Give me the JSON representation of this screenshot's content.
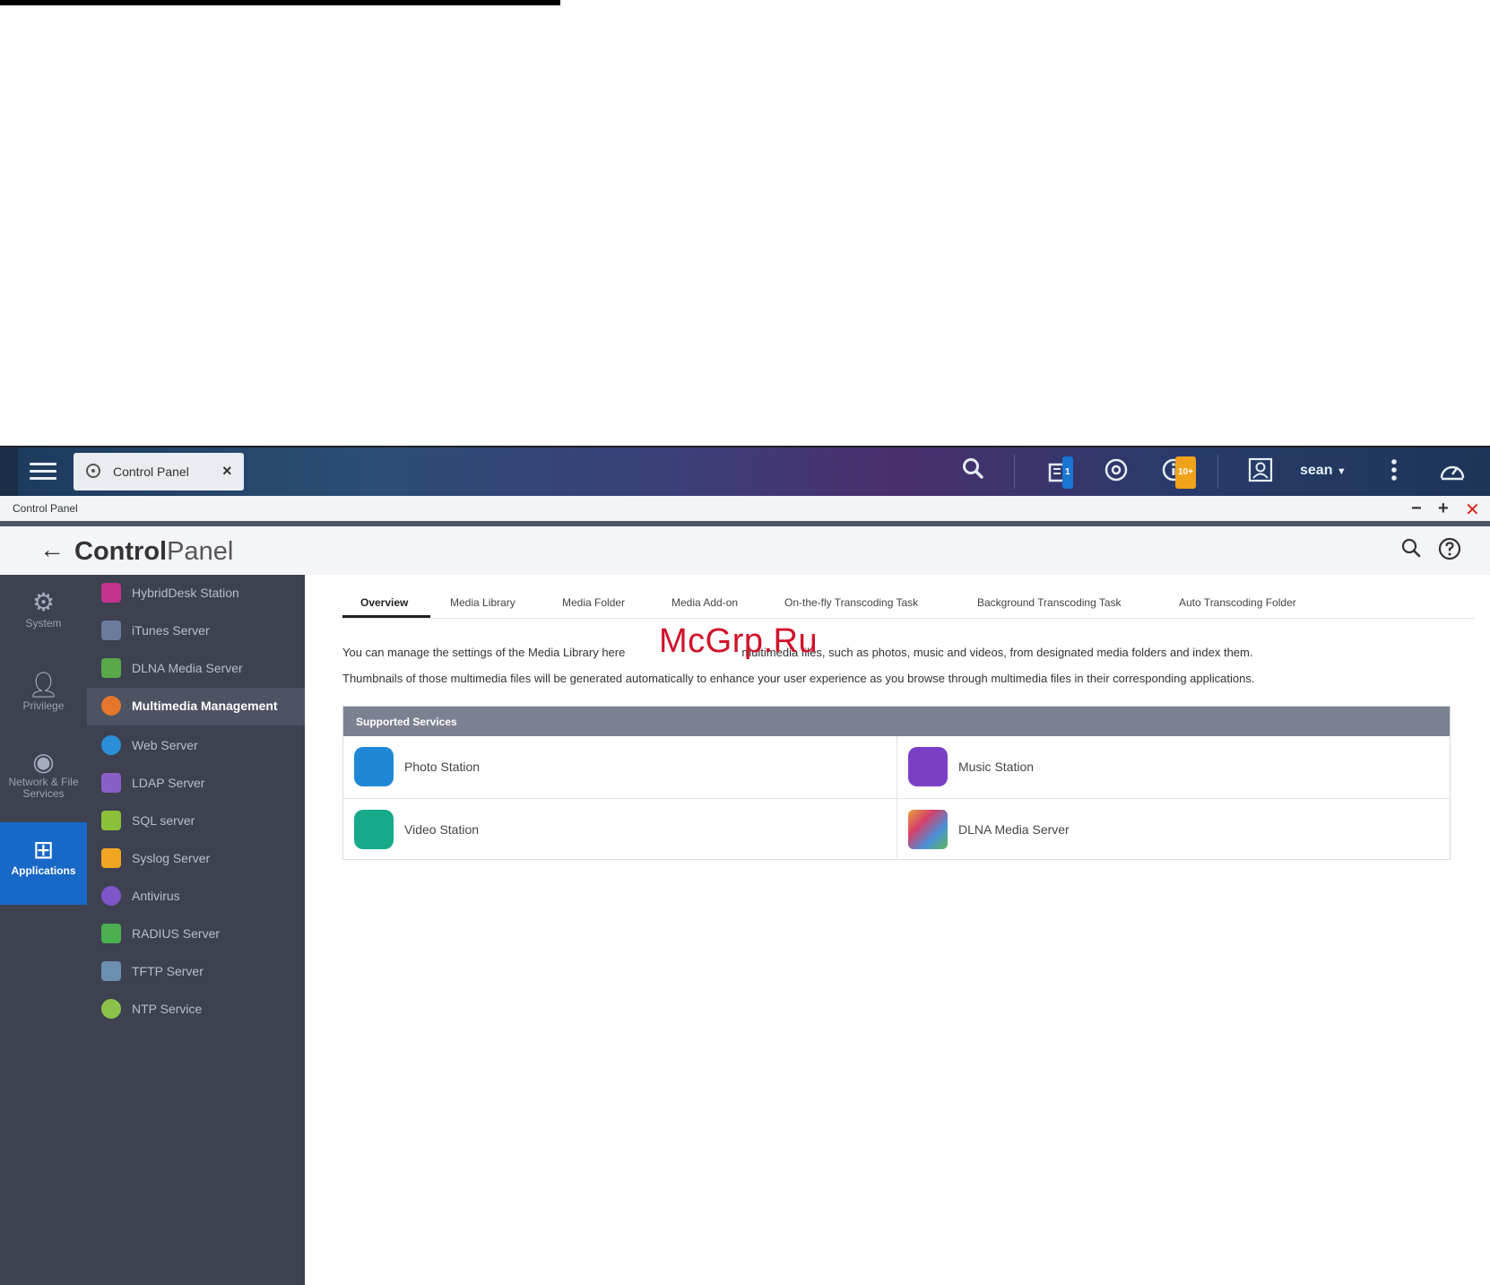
{
  "watermark": "McGrp.Ru",
  "taskbar": {
    "app_tab_label": "Control Panel",
    "notification_badge": "1",
    "events_badge": "10+",
    "user": "sean"
  },
  "window": {
    "title": "Control Panel",
    "header_title_bold": "Control",
    "header_title_light": "Panel"
  },
  "categories": [
    {
      "label": "System"
    },
    {
      "label": "Privilege"
    },
    {
      "label": "Network & File Services"
    },
    {
      "label": "Applications"
    }
  ],
  "sub_items": [
    {
      "label": "HybridDesk Station",
      "color": "#c2338d"
    },
    {
      "label": "iTunes Server",
      "color": "#6b7b9c"
    },
    {
      "label": "DLNA Media Server",
      "color": "#5aa84a"
    },
    {
      "label": "Multimedia Management",
      "color": "#e4772c"
    },
    {
      "label": "Web Server",
      "color": "#2a8fd6"
    },
    {
      "label": "LDAP Server",
      "color": "#8a5fc7"
    },
    {
      "label": "SQL server",
      "color": "#8cbf3a"
    },
    {
      "label": "Syslog Server",
      "color": "#f0a623"
    },
    {
      "label": "Antivirus",
      "color": "#7e56c9"
    },
    {
      "label": "RADIUS Server",
      "color": "#4caf50"
    },
    {
      "label": "TFTP Server",
      "color": "#6c8fb0"
    },
    {
      "label": "NTP Service",
      "color": "#8bc34a"
    }
  ],
  "tabs": [
    {
      "label": "Overview"
    },
    {
      "label": "Media Library"
    },
    {
      "label": "Media Folder"
    },
    {
      "label": "Media Add-on"
    },
    {
      "label": "On-the-fly Transcoding Task"
    },
    {
      "label": "Background Transcoding Task"
    },
    {
      "label": "Auto Transcoding Folder"
    }
  ],
  "description": {
    "line1_a": "You can manage the settings of the Media Library here",
    "line1_b": "multimedia files, such as photos, music and videos, from designated media folders and index them.",
    "line2": "Thumbnails of those multimedia files will be generated automatically to enhance your user experience as you browse through multimedia files in their corresponding applications."
  },
  "services": {
    "header": "Supported Services",
    "items": [
      {
        "label": "Photo Station",
        "color": "#1e88d6"
      },
      {
        "label": "Music Station",
        "color": "#7b3fc6"
      },
      {
        "label": "Video Station",
        "color": "#16a98a"
      },
      {
        "label": "DLNA Media Server",
        "color": "#e7a23a"
      }
    ]
  }
}
